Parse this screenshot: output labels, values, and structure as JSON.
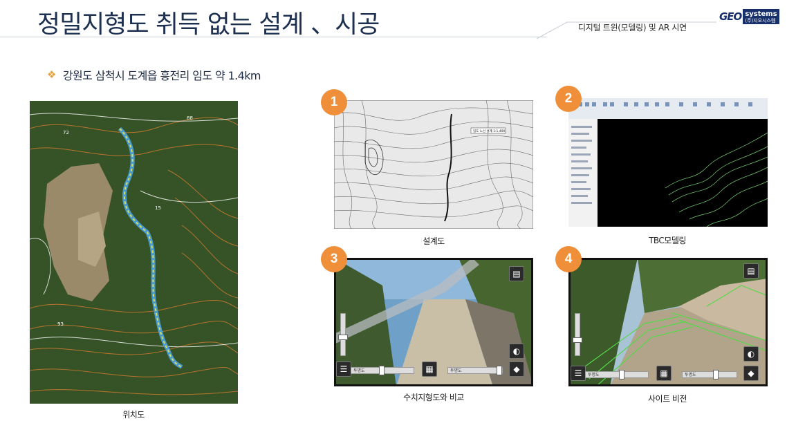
{
  "header": {
    "title": "정밀지형도 취득 없는 설계 、시공",
    "tag": "디지털 트윈(모델링) 및 AR 시연",
    "logo": {
      "geo": "GEO",
      "systems": "systems",
      "sub": "(주)지오시스템"
    }
  },
  "bullet": {
    "text": "강원도 삼척시 도계읍 흥전리 임도 약 1.4km"
  },
  "location_map": {
    "caption": "위치도",
    "labels": [
      "72",
      "88",
      "15",
      "93"
    ]
  },
  "panels": [
    {
      "number": "1",
      "caption": "설계도",
      "inset_label": "임도 노선 설계 1:1,400"
    },
    {
      "number": "2",
      "caption": "TBC모델링"
    },
    {
      "number": "3",
      "caption": "수치지형도와 비교",
      "slider_labels": [
        "투명도",
        "투명도"
      ]
    },
    {
      "number": "4",
      "caption": "사이트 비전",
      "slider_labels": [
        "투명도",
        "투명도"
      ]
    }
  ],
  "colors": {
    "accent": "#ef8f3a",
    "title": "#1d3050",
    "logo_navy": "#17306b"
  }
}
